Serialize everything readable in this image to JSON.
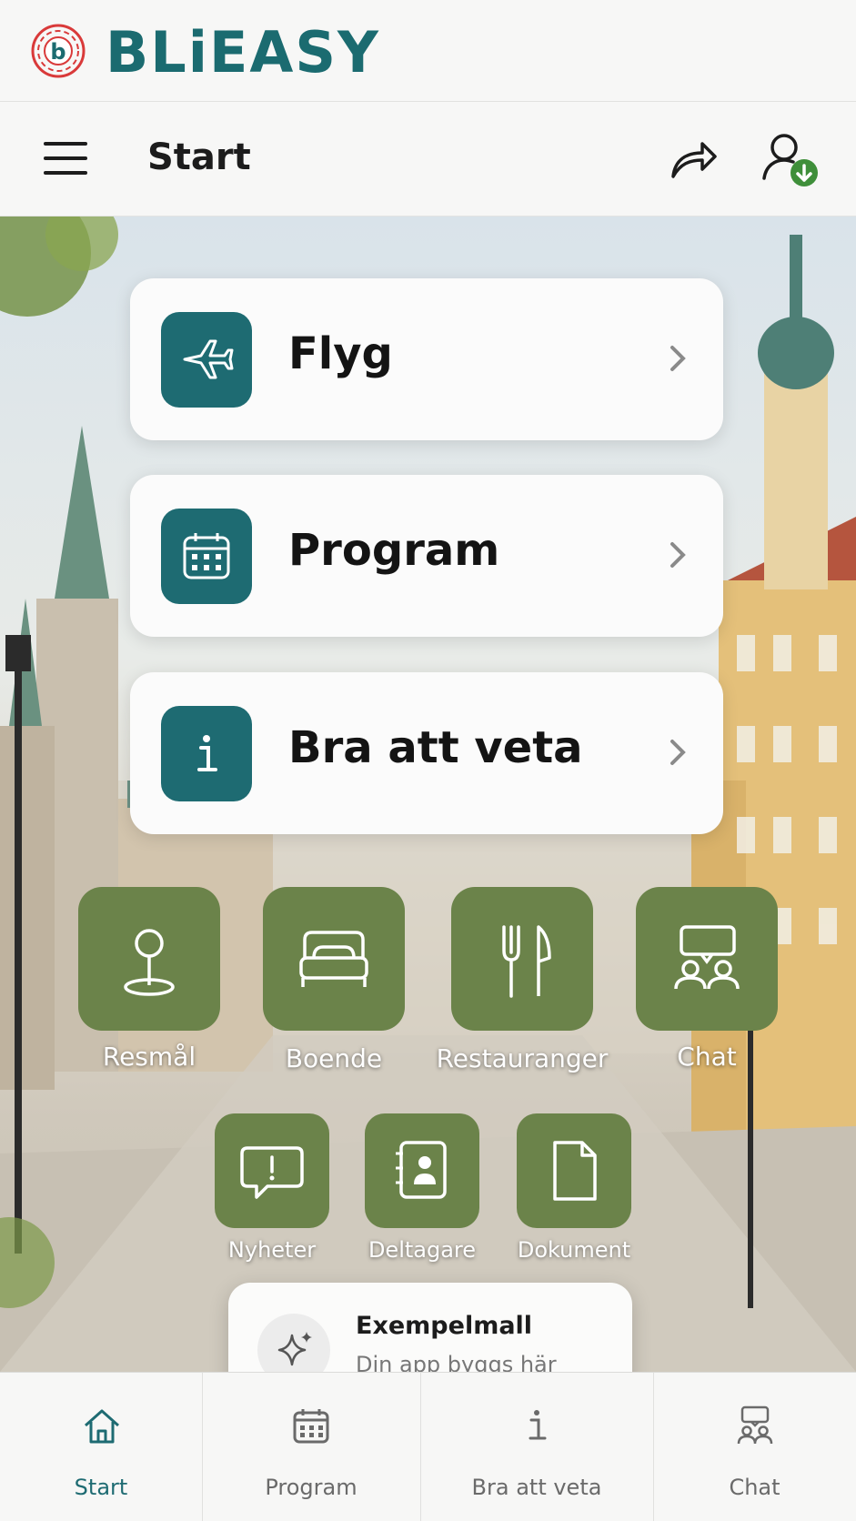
{
  "brand": {
    "name": "BLiEASY",
    "logo_letter": "b"
  },
  "header": {
    "title": "Start"
  },
  "nav_cards": [
    {
      "label": "Flyg",
      "icon": "airplane-icon"
    },
    {
      "label": "Program",
      "icon": "calendar-icon"
    },
    {
      "label": "Bra att veta",
      "icon": "info-icon"
    }
  ],
  "tiles": [
    {
      "label": "Resmål",
      "icon": "location-pin-icon"
    },
    {
      "label": "Boende",
      "icon": "bed-icon"
    },
    {
      "label": "Restauranger",
      "icon": "fork-knife-icon"
    },
    {
      "label": "Chat",
      "icon": "chat-people-icon"
    },
    {
      "label": "Nyheter",
      "icon": "news-alert-icon"
    },
    {
      "label": "Deltagare",
      "icon": "contacts-icon"
    },
    {
      "label": "Dokument",
      "icon": "document-icon"
    }
  ],
  "toast": {
    "title": "Exempelmall",
    "subtitle": "Din app byggs här",
    "icon": "sparkle-icon"
  },
  "tabbar": [
    {
      "label": "Start",
      "icon": "home-icon",
      "active": true
    },
    {
      "label": "Program",
      "icon": "calendar-icon",
      "active": false
    },
    {
      "label": "Bra att veta",
      "icon": "info-icon",
      "active": false
    },
    {
      "label": "Chat",
      "icon": "chat-people-icon",
      "active": false
    }
  ],
  "colors": {
    "teal": "#1e6b72",
    "olive": "#6b834a",
    "brand_red": "#d93a3a",
    "badge_green": "#3f8f3a"
  }
}
